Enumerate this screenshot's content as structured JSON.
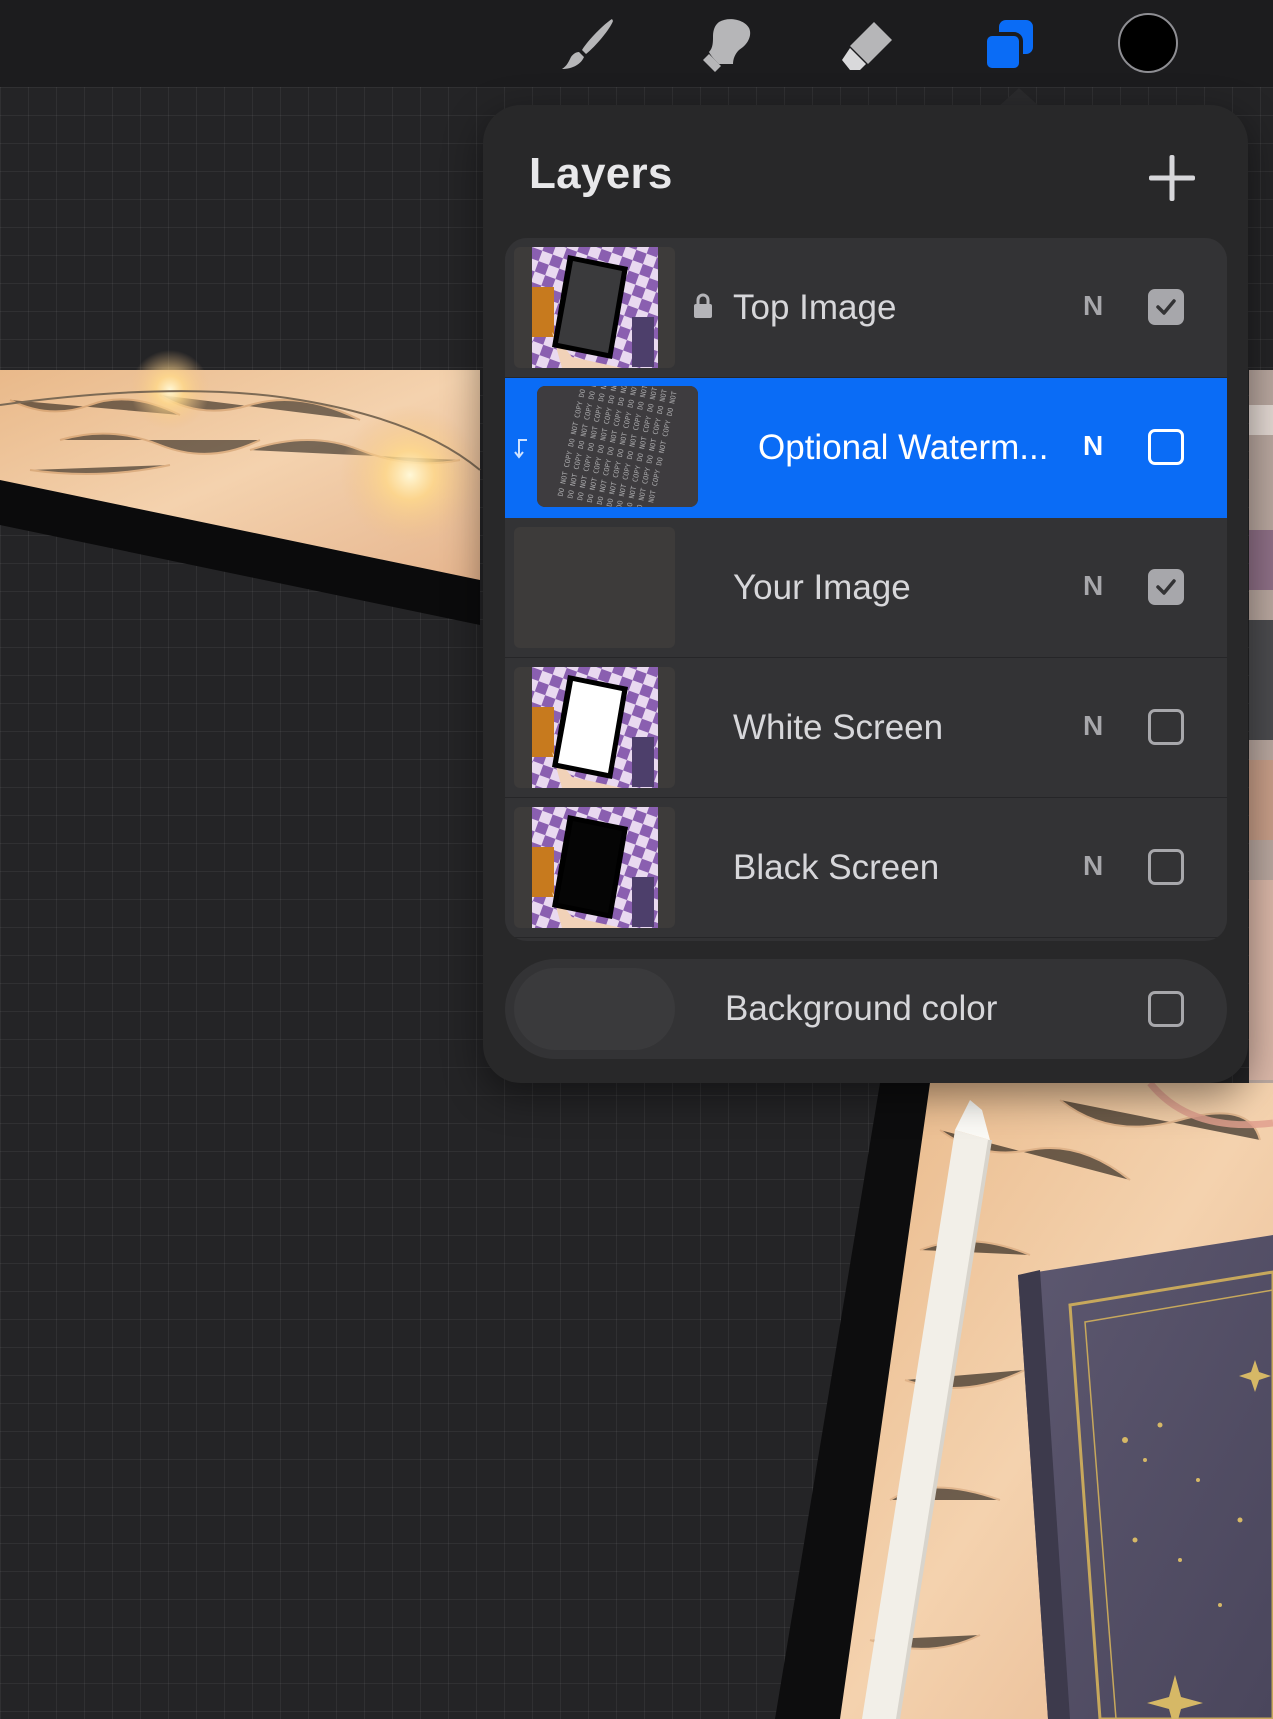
{
  "toolbar": {
    "tools": [
      {
        "name": "brush-icon",
        "selected": false
      },
      {
        "name": "smudge-icon",
        "selected": false
      },
      {
        "name": "eraser-icon",
        "selected": false
      },
      {
        "name": "layers-icon",
        "selected": true
      }
    ],
    "active_color": "#000000",
    "accent_color": "#0a6cf6"
  },
  "layers_panel": {
    "title": "Layers",
    "add_icon": "plus-icon",
    "layers": [
      {
        "name": "Top Image",
        "blend_mode": "N",
        "visible": true,
        "locked": true,
        "selected": false,
        "thumbnail": "tablet-dark-screen"
      },
      {
        "name": "Optional Waterm...",
        "blend_mode": "N",
        "visible": false,
        "locked": false,
        "selected": true,
        "clipped": true,
        "thumbnail": "watermark-pattern"
      },
      {
        "name": "Your Image",
        "blend_mode": "N",
        "visible": true,
        "locked": false,
        "selected": false,
        "thumbnail": "empty"
      },
      {
        "name": "White Screen",
        "blend_mode": "N",
        "visible": false,
        "locked": false,
        "selected": false,
        "thumbnail": "tablet-white-screen"
      },
      {
        "name": "Black Screen",
        "blend_mode": "N",
        "visible": false,
        "locked": false,
        "selected": false,
        "thumbnail": "tablet-black-screen"
      }
    ],
    "background": {
      "label": "Background color",
      "visible": false,
      "color": "#3a3a3c"
    }
  }
}
